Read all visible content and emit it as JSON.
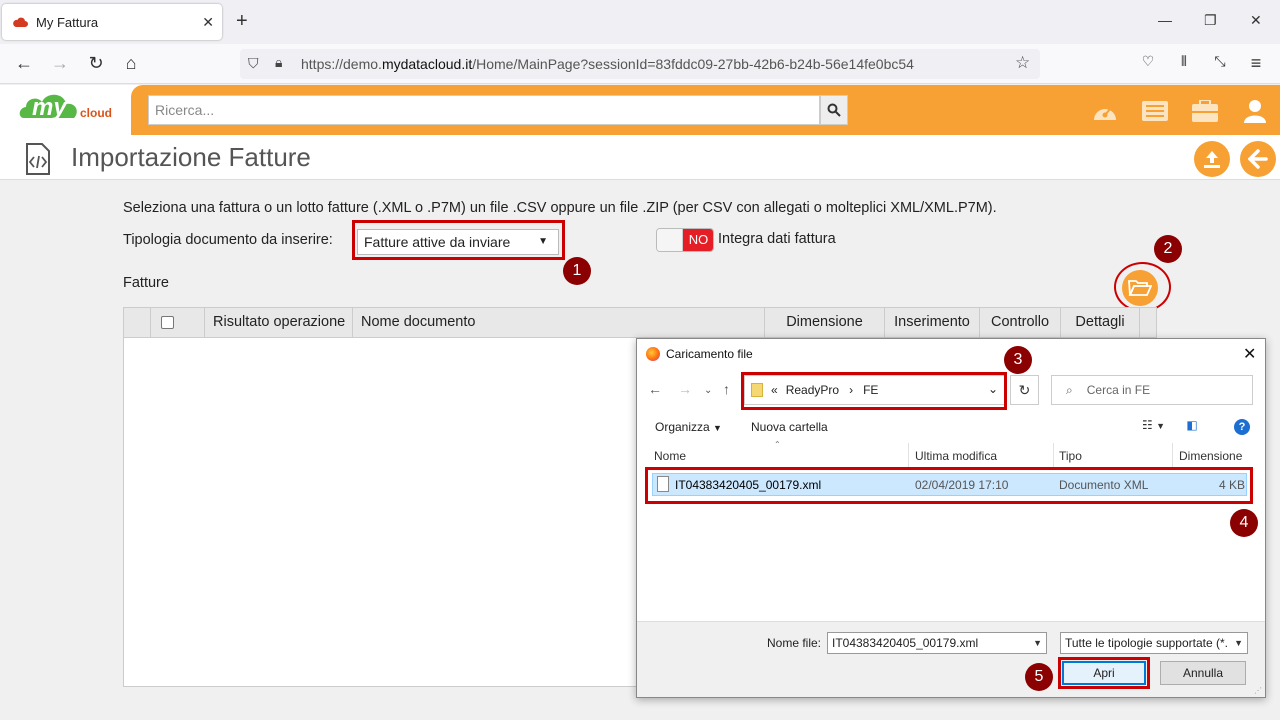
{
  "browser": {
    "tab_title": "My Fattura",
    "url_prefix": "https://demo.",
    "url_domain": "mydatacloud.it",
    "url_path": "/Home/MainPage?sessionId=83fddc09-27bb-42b6-b24b-56e14fe0bc54"
  },
  "header": {
    "logo_text": "my",
    "logo_sub": "cloud",
    "search_placeholder": "Ricerca..."
  },
  "page": {
    "title": "Importazione Fatture",
    "instructions": "Seleziona una fattura o un lotto fatture (.XML o .P7M) un file .CSV oppure un file .ZIP (per CSV con allegati o molteplici XML/XML.P7M).",
    "tipologia_label": "Tipologia documento da inserire:",
    "tipologia_value": "Fatture attive da inviare",
    "toggle_state": "NO",
    "toggle_label": "Integra dati fattura",
    "fatture_label": "Fatture",
    "columns": [
      "Risultato operazione",
      "Nome documento",
      "Dimensione",
      "Inserimento",
      "Controllo",
      "Dettagli"
    ]
  },
  "markers": [
    "1",
    "2",
    "3",
    "4",
    "5"
  ],
  "dialog": {
    "title": "Caricamento file",
    "path_prefix": "«",
    "path_1": "ReadyPro",
    "path_sep": "›",
    "path_2": "FE",
    "search_placeholder": "Cerca in FE",
    "organizza": "Organizza",
    "nuova_cartella": "Nuova cartella",
    "columns": {
      "nome": "Nome",
      "modifica": "Ultima modifica",
      "tipo": "Tipo",
      "dimensione": "Dimensione"
    },
    "file": {
      "nome": "IT04383420405_00179.xml",
      "modifica": "02/04/2019 17:10",
      "tipo": "Documento XML",
      "dimensione": "4 KB"
    },
    "filename_label": "Nome file:",
    "filename_value": "IT04383420405_00179.xml",
    "filetype_value": "Tutte le tipologie supportate (*.",
    "apri": "Apri",
    "annulla": "Annulla"
  },
  "colors": {
    "orange": "#f7a034",
    "marker": "#8b0000",
    "highlight": "#cc0000"
  }
}
